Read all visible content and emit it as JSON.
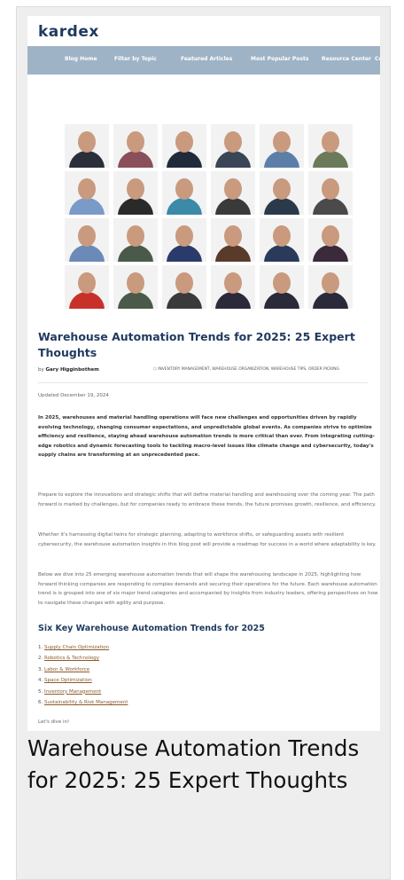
{
  "logo": "kardex",
  "nav": [
    "Blog Home",
    "Filter by Topic",
    "Featured Articles",
    "Most Popular Posts",
    "Resource Center",
    "Co"
  ],
  "photo_colors": [
    "#2a2f3a",
    "#8a4f5a",
    "#1f2a3a",
    "#3a4656",
    "#5b7fa8",
    "#6a7a5a",
    "#7a9ac8",
    "#2a2a2a",
    "#3a8aa8",
    "#3a3a3a",
    "#2a3a4a",
    "#4a4a4a",
    "#6b8ab8",
    "#4a5a4a",
    "#2a3a6a",
    "#5a3a2a",
    "#2a3a5a",
    "#3a2a3a",
    "#c8302a",
    "#4a5a4a",
    "#3a3a3a",
    "#2a2a3a",
    "#2a2a3a",
    "#2a2a3a"
  ],
  "article": {
    "title": "Warehouse Automation Trends for 2025: 25 Expert Thoughts",
    "by": "by",
    "author": "Gary Higginbothem",
    "tags": "INVENTORY MANAGEMENT, WAREHOUSE ORGANIZATION, WAREHOUSE TIPS, ORDER PICKING",
    "updated": "Updated December 19, 2024",
    "intro": "In 2025, warehouses and material handling operations will face new challenges and opportunities driven by rapidly evolving technology, changing consumer expectations, and unpredictable global events. As companies strive to optimize efficiency and resilience, staying ahead warehouse automation trends is more critical than ever. From integrating cutting-edge robotics and dynamic forecasting tools to tackling macro-level issues like climate change and cybersecurity, today's supply chains are transforming at an unprecedented pace.",
    "para1": "Prepare to explore the innovations and strategic shifts that will define material handling and warehousing over the coming year. The path forward is marked by challenges, but for companies ready to embrace these trends, the future promises growth, resilience, and efficiency.",
    "para2": "Whether it's harnessing digital twins for strategic planning, adapting to workforce shifts, or safeguarding assets with resilient cybersecurity, the warehouse automation insights in this blog post will provide a roadmap for success in a world where adaptability is key.",
    "para3": "Below we dive into 25 emerging warehouse automation trends that will shape the warehousing landscape in 2025, highlighting how forward thinking companies are responding to complex demands and securing their operations for the future. Each warehouse automation trend is is grouped into one of six major trend categories and accompanied by insights from industry leaders, offering perspectives on how to navigate these changes with agility and purpose.",
    "subheading": "Six Key Warehouse Automation Trends for 2025",
    "list": [
      {
        "num": "1.",
        "label": "Supply Chain Optimization"
      },
      {
        "num": "2.",
        "label": "Robotics & Technology"
      },
      {
        "num": "3.",
        "label": "Labor & Workforce"
      },
      {
        "num": "4.",
        "label": "Space Optimization"
      },
      {
        "num": "5.",
        "label": "Inventory Management"
      },
      {
        "num": "6.",
        "label": "Sustainability & Risk Management"
      }
    ],
    "dive": "Let's dive in!"
  },
  "caption": "Warehouse Automation Trends for 2025: 25 Expert Thoughts"
}
